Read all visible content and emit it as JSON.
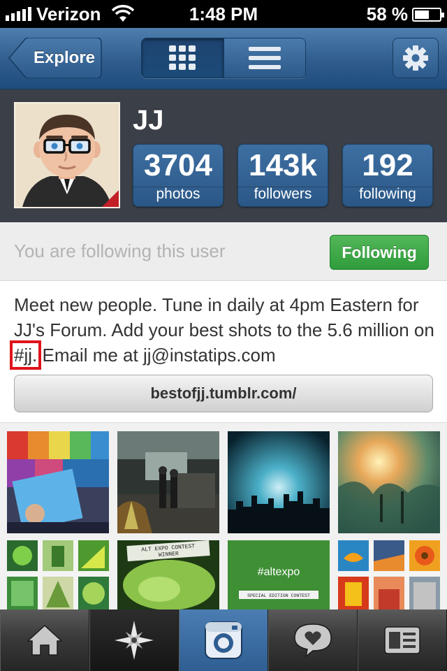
{
  "status_bar": {
    "carrier": "Verizon",
    "time": "1:48 PM",
    "battery": "58 %",
    "battery_level": 0.58
  },
  "nav": {
    "back_label": "Explore",
    "view_grid_icon": "grid-icon",
    "view_list_icon": "list-icon",
    "settings_icon": "gear-icon"
  },
  "profile": {
    "username": "JJ",
    "stats": [
      {
        "number": "3704",
        "label": "photos"
      },
      {
        "number": "143k",
        "label": "followers"
      },
      {
        "number": "192",
        "label": "following"
      }
    ]
  },
  "follow": {
    "status_text": "You are following this user",
    "button_label": "Following"
  },
  "bio": {
    "text_part1": "Meet new people. Tune in daily at 4pm Eastern for JJ's Forum.  Add your best shots to the 5.6 million on ",
    "hashtag": "#jj.",
    "text_part2": " Email me at jj@instatips.com",
    "link": "bestofjj.tumblr.com/"
  },
  "grid": {
    "overlay_texts": {
      "contest_banner_line1": "ALT EXPO CONTEST",
      "contest_banner_line2": "WINNER",
      "altexpo_tag": "#altexpo",
      "altexpo_sub": "SPECIAL EDITION CONTEST"
    }
  },
  "tabbar": {
    "tabs": [
      {
        "icon": "home-icon"
      },
      {
        "icon": "explore-star-icon"
      },
      {
        "icon": "camera-icon"
      },
      {
        "icon": "news-heart-icon"
      },
      {
        "icon": "profile-card-icon"
      }
    ]
  }
}
